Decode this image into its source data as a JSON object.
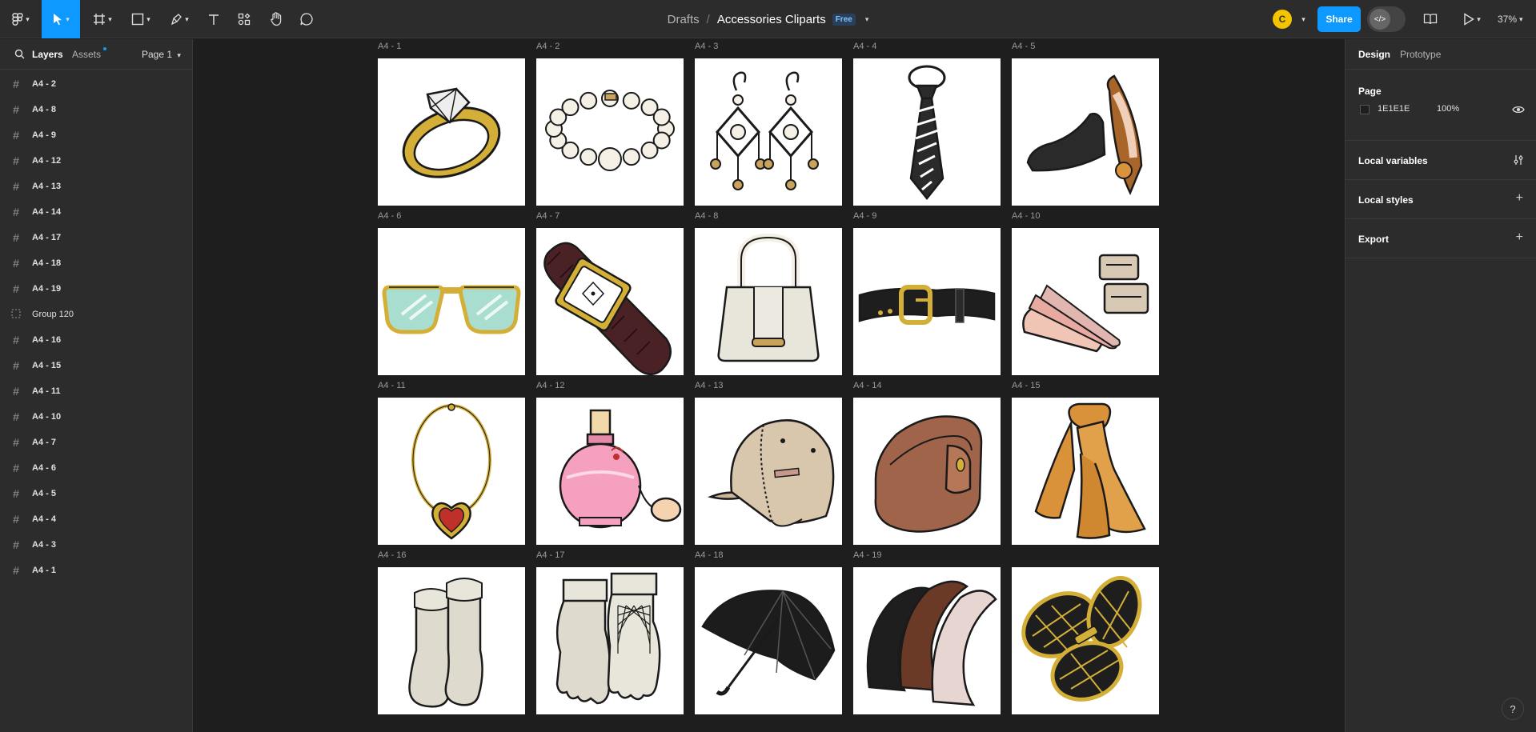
{
  "topbar": {
    "breadcrumb_drafts": "Drafts",
    "breadcrumb_sep": "/",
    "file_name": "Accessories Cliparts",
    "plan_badge": "Free",
    "avatar_initial": "C",
    "share_label": "Share",
    "zoom_label": "37%"
  },
  "left_panel": {
    "tab_layers": "Layers",
    "tab_assets": "Assets",
    "page_select": "Page 1",
    "layers": [
      {
        "label": "A4 - 2",
        "type": "frame"
      },
      {
        "label": "A4 - 8",
        "type": "frame"
      },
      {
        "label": "A4 - 9",
        "type": "frame"
      },
      {
        "label": "A4 - 12",
        "type": "frame"
      },
      {
        "label": "A4 - 13",
        "type": "frame"
      },
      {
        "label": "A4 - 14",
        "type": "frame"
      },
      {
        "label": "A4 - 17",
        "type": "frame"
      },
      {
        "label": "A4 - 18",
        "type": "frame"
      },
      {
        "label": "A4 - 19",
        "type": "frame"
      },
      {
        "label": "Group 120",
        "type": "group"
      },
      {
        "label": "A4 - 16",
        "type": "frame"
      },
      {
        "label": "A4 - 15",
        "type": "frame"
      },
      {
        "label": "A4 - 11",
        "type": "frame"
      },
      {
        "label": "A4 - 10",
        "type": "frame"
      },
      {
        "label": "A4 - 7",
        "type": "frame"
      },
      {
        "label": "A4 - 6",
        "type": "frame"
      },
      {
        "label": "A4 - 5",
        "type": "frame"
      },
      {
        "label": "A4 - 4",
        "type": "frame"
      },
      {
        "label": "A4 - 3",
        "type": "frame"
      },
      {
        "label": "A4 - 1",
        "type": "frame"
      }
    ]
  },
  "canvas": {
    "frames": [
      {
        "label": "A4 - 1",
        "icon": "ring-icon"
      },
      {
        "label": "A4 - 2",
        "icon": "pearl-bracelet-icon"
      },
      {
        "label": "A4 - 3",
        "icon": "earrings-icon"
      },
      {
        "label": "A4 - 4",
        "icon": "necktie-icon"
      },
      {
        "label": "A4 - 5",
        "icon": "shoes-icon"
      },
      {
        "label": "A4 - 6",
        "icon": "sunglasses-icon"
      },
      {
        "label": "A4 - 7",
        "icon": "wristwatch-icon"
      },
      {
        "label": "A4 - 8",
        "icon": "handbag-icon"
      },
      {
        "label": "A4 - 9",
        "icon": "belt-icon"
      },
      {
        "label": "A4 - 10",
        "icon": "hair-clips-icon"
      },
      {
        "label": "A4 - 11",
        "icon": "necklace-icon"
      },
      {
        "label": "A4 - 12",
        "icon": "perfume-icon"
      },
      {
        "label": "A4 - 13",
        "icon": "cap-icon"
      },
      {
        "label": "A4 - 14",
        "icon": "wallet-icon"
      },
      {
        "label": "A4 - 15",
        "icon": "scarf-icon"
      },
      {
        "label": "A4 - 16",
        "icon": "socks-icon"
      },
      {
        "label": "A4 - 17",
        "icon": "gloves-icon"
      },
      {
        "label": "A4 - 18",
        "icon": "umbrella-icon"
      },
      {
        "label": "A4 - 19",
        "icon": "headbands-icon"
      },
      {
        "label": "",
        "icon": "cufflinks-icon"
      }
    ]
  },
  "right_panel": {
    "tab_design": "Design",
    "tab_prototype": "Prototype",
    "page_title": "Page",
    "page_color": "1E1E1E",
    "page_opacity": "100%",
    "local_variables": "Local variables",
    "local_styles": "Local styles",
    "export": "Export"
  },
  "help_label": "?"
}
